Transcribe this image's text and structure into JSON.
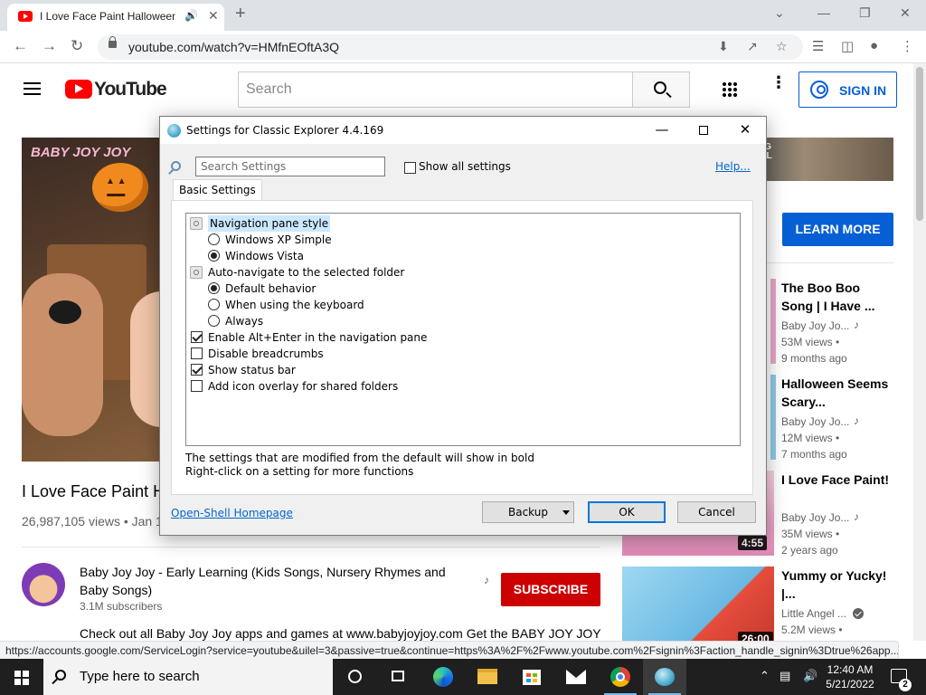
{
  "browser": {
    "tab_title": "I Love Face Paint Halloween",
    "new_tab_symbol": "+",
    "url": "youtube.com/watch?v=HMfnEOftA3Q",
    "status_url": "https://accounts.google.com/ServiceLogin?service=youtube&uilel=3&passive=true&continue=https%3A%2F%2Fwww.youtube.com%2Fsignin%3Faction_handle_signin%3Dtrue%26app..."
  },
  "youtube": {
    "brand": "YouTube",
    "search_placeholder": "Search",
    "signin_label": "SIGN IN",
    "video": {
      "overlay_logo": "BABY JOY JOY",
      "title": "I Love Face Paint H",
      "meta": "26,987,105 views • Jan 1",
      "channel_name": "Baby Joy Joy - Early Learning (Kids Songs, Nursery Rhymes and Baby Songs)",
      "subscribers": "3.1M subscribers",
      "subscribe_label": "SUBSCRIBE",
      "description": "Check out all Baby Joy Joy apps and games at www.babyjoyjoy.com Get the BABY JOY JOY"
    },
    "ad": {
      "banner_text": "HING\nSELL\nNG",
      "learn_more": "LEARN MORE"
    },
    "recommendations": [
      {
        "title": "The Boo Boo Song | I Have ...",
        "channel": "Baby Joy Jo...",
        "views": "53M views •",
        "age": "9 months ago",
        "duration": "",
        "badge": "music",
        "thumb_color": "#e7a7c7"
      },
      {
        "title": "Halloween Seems Scary...",
        "channel": "Baby Joy Jo...",
        "views": "12M views •",
        "age": "7 months ago",
        "duration": "",
        "badge": "music",
        "thumb_color": "#8ec9e6"
      },
      {
        "title": "I Love Face Paint!",
        "channel": "Baby Joy Jo...",
        "views": "35M views •",
        "age": "2 years ago",
        "duration": "4:55",
        "badge": "music",
        "thumb_color": "#f1b6d2"
      },
      {
        "title": "Yummy or Yucky! |...",
        "channel": "Little Angel ...",
        "views": "5.2M views •",
        "age": "",
        "duration": "26:00",
        "badge": "verified",
        "thumb_color": "#7fc6ea"
      }
    ]
  },
  "dialog": {
    "title": "Settings for Classic Explorer 4.4.169",
    "search_placeholder": "Search Settings",
    "show_all_label": "Show all settings",
    "show_all_checked": false,
    "help_label": "Help...",
    "tab_label": "Basic Settings",
    "options": [
      {
        "kind": "group",
        "label": "Navigation pane style",
        "selected": true
      },
      {
        "kind": "radio",
        "label": "Windows XP Simple",
        "checked": false
      },
      {
        "kind": "radio",
        "label": "Windows Vista",
        "checked": true
      },
      {
        "kind": "group",
        "label": "Auto-navigate to the selected folder",
        "selected": false
      },
      {
        "kind": "radio",
        "label": "Default behavior",
        "checked": true
      },
      {
        "kind": "radio",
        "label": "When using the keyboard",
        "checked": false
      },
      {
        "kind": "radio",
        "label": "Always",
        "checked": false
      },
      {
        "kind": "check",
        "label": "Enable Alt+Enter in the navigation pane",
        "checked": true
      },
      {
        "kind": "check",
        "label": "Disable breadcrumbs",
        "checked": false
      },
      {
        "kind": "check",
        "label": "Show status bar",
        "checked": true
      },
      {
        "kind": "check",
        "label": "Add icon overlay for shared folders",
        "checked": false
      }
    ],
    "note_line1": "The settings that are modified from the default will show in bold",
    "note_line2": "Right-click on a setting for more functions",
    "homepage_link": "Open-Shell Homepage",
    "backup_label": "Backup",
    "ok_label": "OK",
    "cancel_label": "Cancel"
  },
  "taskbar": {
    "search_text": "Type here to search",
    "time": "12:40 AM",
    "date": "5/21/2022",
    "notification_count": "2"
  }
}
